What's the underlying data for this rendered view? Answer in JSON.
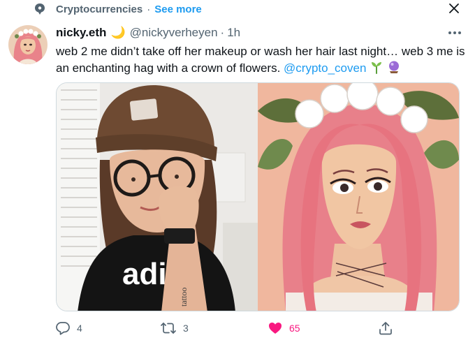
{
  "context": {
    "topic": "Cryptocurrencies",
    "dot": "·",
    "see_more": "See more"
  },
  "tweet": {
    "display_name": "nicky.eth",
    "name_emoji": "🌙",
    "handle": "@nickyverheyen",
    "separator": "·",
    "time": "1h",
    "text_before": "web 2 me didn’t take off her makeup or wash her hair last night… web 3 me is an enchanting hag with a crown of flowers. ",
    "mention": "@crypto_coven",
    "emojis": [
      "seedling-icon",
      "crystal-ball-icon"
    ]
  },
  "actions": {
    "reply_count": "4",
    "retweet_count": "3",
    "like_count": "65"
  },
  "colors": {
    "accent": "#1d9bf0",
    "secondary_text": "#536471",
    "like": "#f91880"
  },
  "photo_left_text": "adi"
}
